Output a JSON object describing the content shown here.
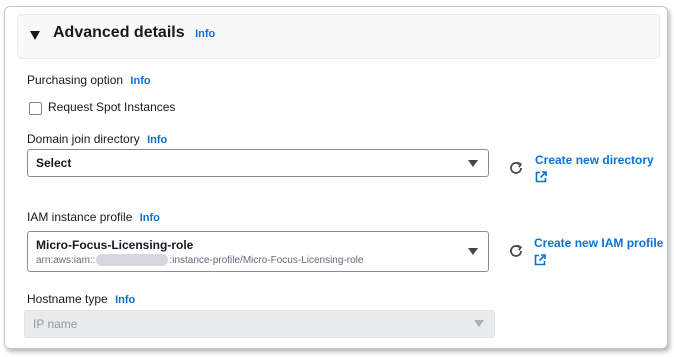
{
  "section": {
    "title": "Advanced details",
    "info": "Info"
  },
  "purchasing": {
    "label": "Purchasing option",
    "info": "Info",
    "spot_label": "Request Spot Instances",
    "spot_checked": false
  },
  "domain_join": {
    "label": "Domain join directory",
    "info": "Info",
    "selected": "Select",
    "create_link": "Create new directory"
  },
  "iam": {
    "label": "IAM instance profile",
    "info": "Info",
    "selected": "Micro-Focus-Licensing-role",
    "arn_prefix": "arn:aws:iam::",
    "arn_suffix": ":instance-profile/Micro-Focus-Licensing-role",
    "create_link": "Create new IAM profile"
  },
  "hostname": {
    "label": "Hostname type",
    "info": "Info",
    "selected": "IP name",
    "disabled": true
  },
  "colors": {
    "link": "#0972d3",
    "text": "#16191f",
    "disabled_bg": "#e9ebed"
  },
  "icons": [
    "caret-down-icon",
    "refresh-icon",
    "external-link-icon",
    "dropdown-arrow-icon"
  ]
}
